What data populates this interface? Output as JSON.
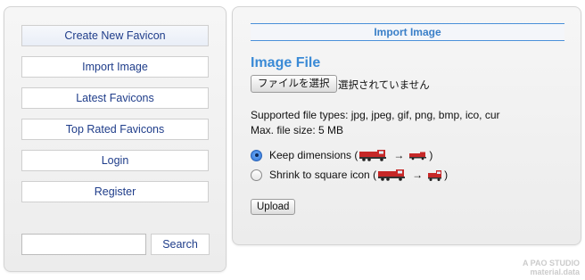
{
  "sidebar": {
    "items": [
      {
        "label": "Create New Favicon"
      },
      {
        "label": "Import Image"
      },
      {
        "label": "Latest Favicons"
      },
      {
        "label": "Top Rated Favicons"
      },
      {
        "label": "Login"
      },
      {
        "label": "Register"
      }
    ],
    "search": {
      "value": "",
      "button_label": "Search"
    }
  },
  "main": {
    "header": "Import Image",
    "title": "Image File",
    "file_input": {
      "button_label": "ファイルを選択",
      "status": "選択されていません"
    },
    "supported_types": "Supported file types: jpg, jpeg, gif, png, bmp, ico, cur",
    "max_size": "Max. file size: 5 MB",
    "options": [
      {
        "label": "Keep dimensions (",
        "suffix": ")",
        "checked": true
      },
      {
        "label": "Shrink to square icon (",
        "suffix": ")",
        "checked": false
      }
    ],
    "arrow": "→",
    "upload_label": "Upload"
  },
  "watermark": {
    "line1": "A PAO STUDIO",
    "line2": "material.data"
  },
  "colors": {
    "accent": "#3a8ad6",
    "link": "#1f3d8a",
    "truck_red": "#c62828"
  }
}
